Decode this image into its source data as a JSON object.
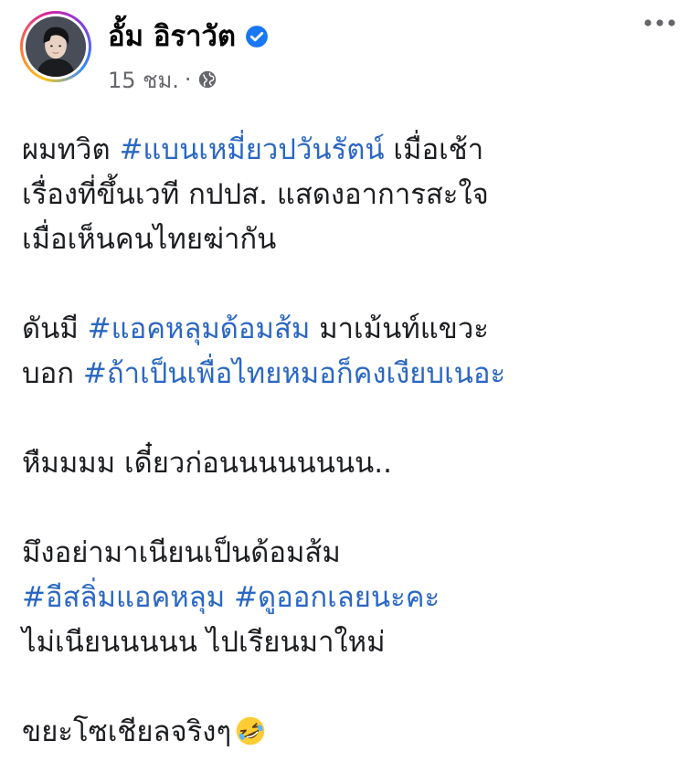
{
  "author": {
    "name": "อั้ม อิราวัต",
    "verified_icon": "verified-badge-icon",
    "accent_color": "#1877f2"
  },
  "meta": {
    "time": "15 ชม.",
    "separator": "·",
    "audience_icon": "globe-icon"
  },
  "more_icon": "more-options-icon",
  "post": {
    "lines": [
      [
        {
          "text": "ผมทวิต "
        },
        {
          "text": "#แบนเหมี่ยวปวันรัตน์",
          "hashtag": true
        },
        {
          "text": " เมื่อเช้า"
        }
      ],
      [
        {
          "text": "เรื่องที่ขึ้นเวที กปปส. แสดงอาการสะใจ"
        }
      ],
      [
        {
          "text": "เมื่อเห็นคนไทยฆ่ากัน"
        }
      ],
      [],
      [
        {
          "text": "ดันมี "
        },
        {
          "text": "#แอคหลุมด้อมส้ม",
          "hashtag": true
        },
        {
          "text": " มาเม้นท์แขวะ"
        }
      ],
      [
        {
          "text": "บอก "
        },
        {
          "text": "#ถ้าเป็นเพื่อไทยหมอก็คงเงียบเนอะ",
          "hashtag": true
        }
      ],
      [],
      [
        {
          "text": "หืมมมม เดี๋ยวก่อนนนนนนนน.."
        }
      ],
      [],
      [
        {
          "text": "มึงอย่ามาเนียนเป็นด้อมส้ม"
        }
      ],
      [
        {
          "text": "#อีสลิ่มแอคหลุม",
          "hashtag": true
        },
        {
          "text": " "
        },
        {
          "text": "#ดูออกเลยนะคะ",
          "hashtag": true
        }
      ],
      [
        {
          "text": "ไม่เนียนนนนน ไปเรียนมาใหม่"
        }
      ],
      [],
      [
        {
          "text": "ขยะโซเชียลจริงๆ"
        },
        {
          "emoji": "rolling-on-floor-laughing-emoji-icon"
        }
      ]
    ],
    "hashtag_color": "#2a67c4"
  }
}
